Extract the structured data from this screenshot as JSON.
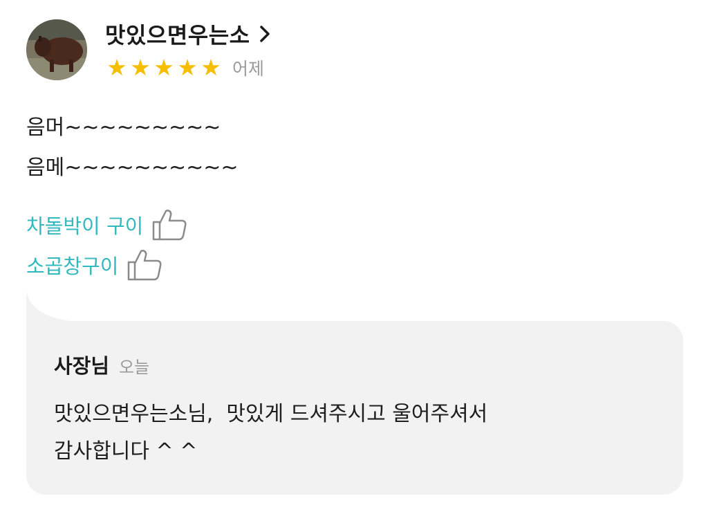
{
  "review": {
    "author": "맛있으면우는소",
    "author_icon": "chevron-right-icon",
    "rating": 5,
    "rating_max": 5,
    "star_color": "#f6be00",
    "date": "어제",
    "body": [
      "음머~~~~~~~~~",
      "음메~~~~~~~~~~"
    ],
    "menu_items": [
      {
        "name": "차돌박이 구이",
        "icon": "thumbs-up-icon"
      },
      {
        "name": "소곱창구이",
        "icon": "thumbs-up-icon"
      }
    ],
    "menu_color": "#32b9bf"
  },
  "reply": {
    "author": "사장님",
    "date": "오늘",
    "lines": [
      "맛있으면우는소님,  맛있게 드셔주시고 울어주셔서",
      "감사합니다 ^ ^"
    ],
    "background": "#f2f2f2"
  }
}
